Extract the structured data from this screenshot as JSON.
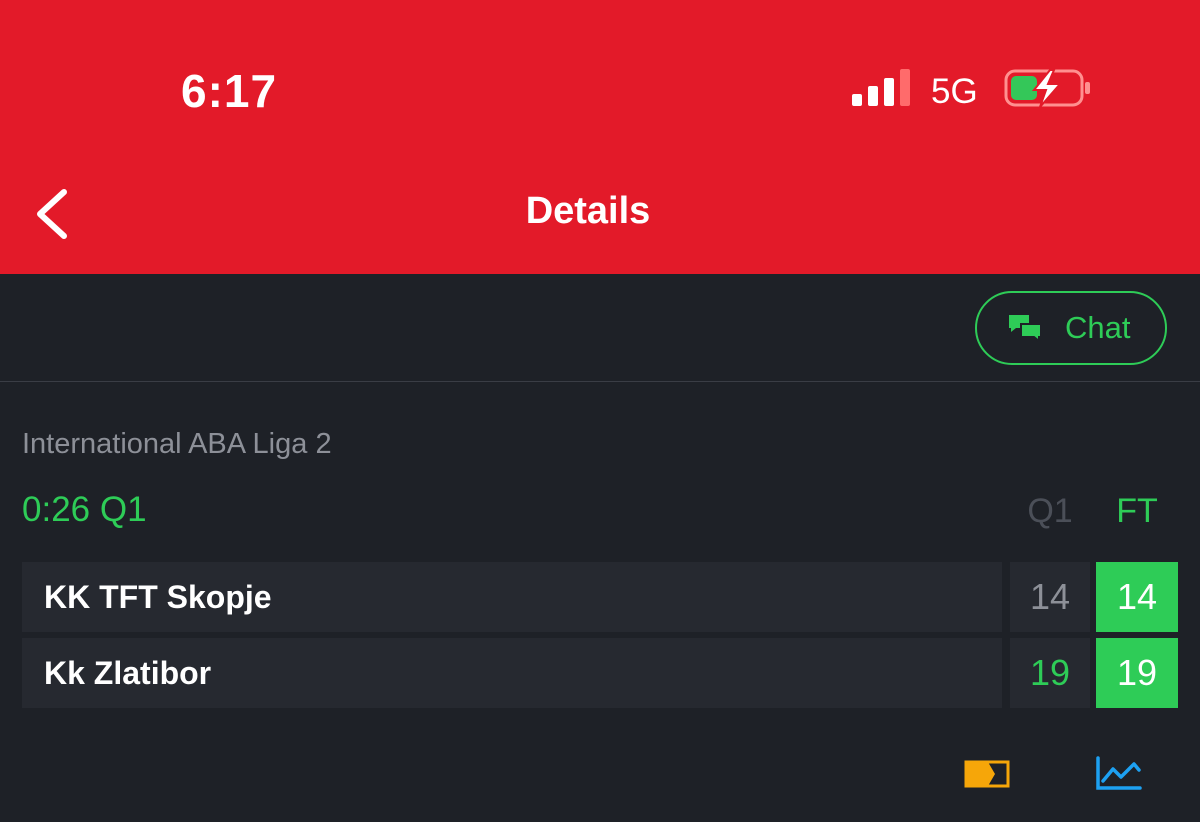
{
  "status_bar": {
    "time": "6:17",
    "network": "5G",
    "signal_icon": "signal-bars-icon",
    "battery_icon": "battery-charging-icon"
  },
  "nav": {
    "title": "Details",
    "back_icon": "chevron-left-icon"
  },
  "chat": {
    "label": "Chat",
    "icon": "chat-bubbles-icon"
  },
  "match": {
    "league": "International ABA Liga 2",
    "status": "0:26 Q1",
    "columns": [
      "Q1",
      "FT"
    ],
    "teams": [
      {
        "name": "KK TFT Skopje",
        "q1": "14",
        "ft": "14"
      },
      {
        "name": "Kk Zlatibor",
        "q1": "19",
        "ft": "19"
      }
    ]
  },
  "actions": {
    "icons": [
      "live-stream-icon",
      "stats-chart-icon"
    ]
  },
  "colors": {
    "header": "#e31a29",
    "background": "#1e2127",
    "accent_green": "#2ecc57",
    "row_bg": "#262930",
    "tv_icon": "#f6a609",
    "chart_icon": "#1da1f2"
  }
}
